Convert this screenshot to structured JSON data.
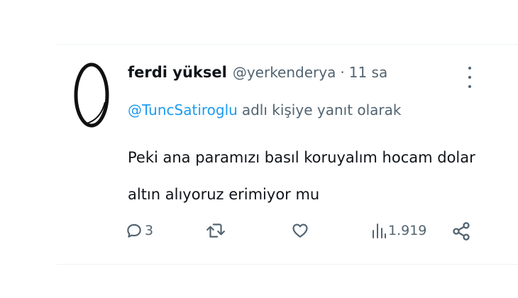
{
  "tweet": {
    "display_name": "ferdi yüksel",
    "handle": "@yerkenderya",
    "separator": "·",
    "time": "11 sa",
    "reply_to_mention": "@TuncSatiroglu",
    "reply_to_suffix": "adlı kişiye yanıt olarak",
    "text_line1": "Peki ana paramızı basıl koruyalım hocam dolar",
    "text_line2": "altın alıyoruz erimiyor mu"
  },
  "actions": {
    "reply_count": "3",
    "views_count": "1.919"
  },
  "icons": {
    "more": "more-vertical-icon",
    "reply": "reply-icon",
    "retweet": "retweet-icon",
    "like": "heart-icon",
    "views": "views-bar-icon",
    "share": "share-icon"
  },
  "colors": {
    "mention": "#1d9bf0",
    "secondary": "#536471",
    "text": "#0f1419"
  }
}
